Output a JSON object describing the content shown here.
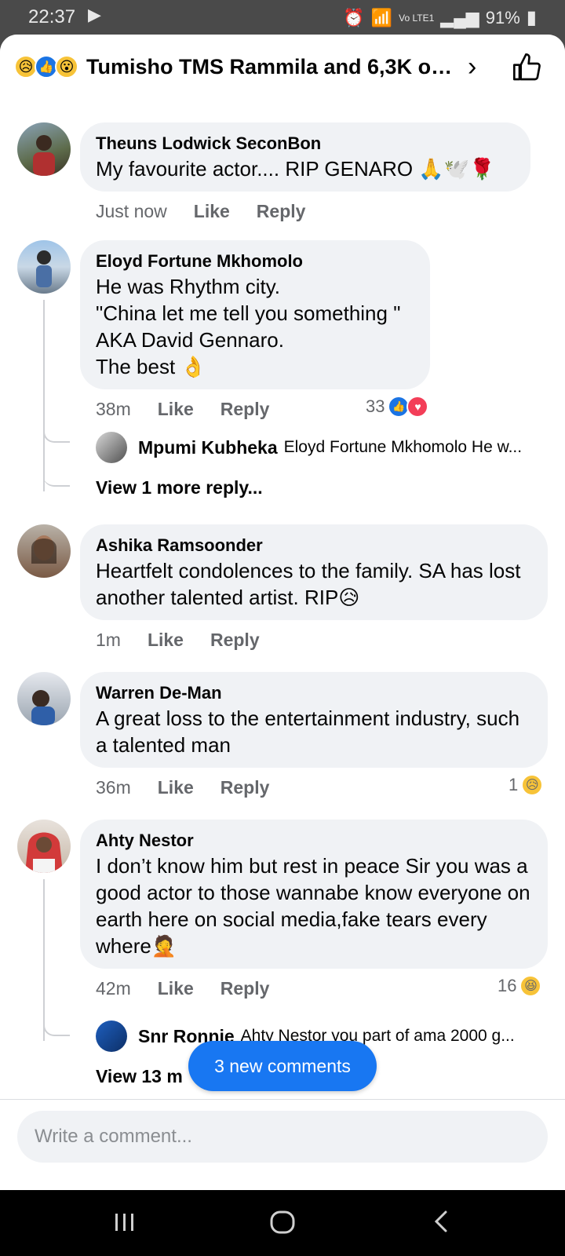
{
  "status_bar": {
    "time": "22:37",
    "network": "Vo LTE1",
    "battery": "91%"
  },
  "header": {
    "title": "Tumisho TMS Rammila and 6,3K ot...",
    "reactions": [
      "sad",
      "like",
      "wow"
    ]
  },
  "comments": [
    {
      "author": "Theuns Lodwick SeconBon",
      "text": "My favourite actor.... RIP  GENARO 🙏🕊️🌹",
      "time": "Just now",
      "like_label": "Like",
      "reply_label": "Reply"
    },
    {
      "author": "Eloyd Fortune Mkhomolo",
      "text": "He was Rhythm city.\n\"China let me tell you something \"\nAKA David Gennaro.\nThe best 👌",
      "time": "38m",
      "like_label": "Like",
      "reply_label": "Reply",
      "reaction_count": "33",
      "reply": {
        "author": "Mpumi Kubheka",
        "text": "Eloyd Fortune Mkhomolo He w..."
      },
      "view_more": "View 1 more reply..."
    },
    {
      "author": "Ashika Ramsoonder",
      "text": "Heartfelt condolences to the family. SA has lost another talented artist. RIP😥",
      "time": "1m",
      "like_label": "Like",
      "reply_label": "Reply"
    },
    {
      "author": "Warren De-Man",
      "text": "A great loss to the entertainment industry, such a talented man",
      "time": "36m",
      "like_label": "Like",
      "reply_label": "Reply",
      "reaction_count": "1"
    },
    {
      "author": "Ahty Nestor",
      "text": "I don’t know him but rest in peace Sir you was a good actor to those wannabe know everyone on earth here on social media,fake tears every where🤦",
      "time": "42m",
      "like_label": "Like",
      "reply_label": "Reply",
      "reaction_count": "16",
      "reply": {
        "author": "Snr Ronnie",
        "text": "Ahty Nestor you part of ama 2000 g..."
      },
      "view_more": "View 13 m"
    }
  ],
  "new_comments_pill": "3 new comments",
  "composer": {
    "placeholder": "Write a comment..."
  },
  "colors": {
    "accent": "#1877f2",
    "bubble": "#f0f2f5",
    "secondary_text": "#65676b"
  }
}
